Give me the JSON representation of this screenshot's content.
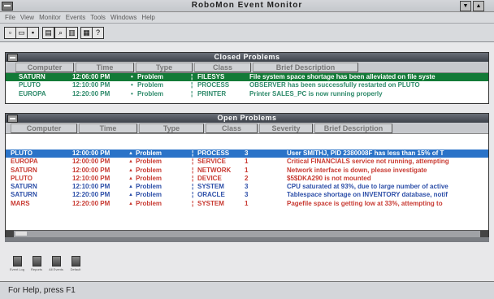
{
  "app": {
    "title": "RoboMon Event Monitor"
  },
  "menu": [
    "File",
    "View",
    "Monitor",
    "Events",
    "Tools",
    "Windows",
    "Help"
  ],
  "toolbar": {
    "icons": [
      "new-icon",
      "open-icon",
      "save-icon",
      "print-icon",
      "find-icon",
      "report-icon",
      "tile-icon",
      "help-icon"
    ]
  },
  "closed": {
    "title": "Closed Problems",
    "headers": [
      "Computer",
      "Time",
      "Type",
      "Class",
      "Brief Description"
    ],
    "rows": [
      {
        "computer": "SATURN",
        "time": "12:06:00 PM",
        "type": "Problem",
        "cls": "FILESYS",
        "desc": "File system space shortage has been alleviated on file syste",
        "sel": true
      },
      {
        "computer": "PLUTO",
        "time": "12:10:00 PM",
        "type": "Problem",
        "cls": "PROCESS",
        "desc": "OBSERVER has been successfully restarted on PLUTO",
        "sel": false
      },
      {
        "computer": "EUROPA",
        "time": "12:20:00 PM",
        "type": "Problem",
        "cls": "PRINTER",
        "desc": "Printer SALES_PC is now running properly",
        "sel": false
      }
    ]
  },
  "open": {
    "title": "Open Problems",
    "headers": [
      "Computer",
      "Time",
      "Type",
      "Class",
      "Severity",
      "Brief Description"
    ],
    "rows": [
      {
        "computer": "PLUTO",
        "time": "12:00:00 PM",
        "type": "Problem",
        "cls": "PROCESS",
        "sev": "3",
        "desc": "User SMITHJ, PID 2380008F has less than 15% of T",
        "sel": true,
        "blue": false
      },
      {
        "computer": "EUROPA",
        "time": "12:00:00 PM",
        "type": "Problem",
        "cls": "SERVICE",
        "sev": "1",
        "desc": "Critical FINANCIALS service not running, attempting",
        "sel": false,
        "blue": false
      },
      {
        "computer": "SATURN",
        "time": "12:00:00 PM",
        "type": "Problem",
        "cls": "NETWORK",
        "sev": "1",
        "desc": "Network interface is down, please investigate",
        "sel": false,
        "blue": false
      },
      {
        "computer": "PLUTO",
        "time": "12:10:00 PM",
        "type": "Problem",
        "cls": "DEVICE",
        "sev": "2",
        "desc": "$5$DKA290 is not mounted",
        "sel": false,
        "blue": false
      },
      {
        "computer": "SATURN",
        "time": "12:10:00 PM",
        "type": "Problem",
        "cls": "SYSTEM",
        "sev": "3",
        "desc": "CPU saturated at 93%, due to large number of active",
        "sel": false,
        "blue": true
      },
      {
        "computer": "SATURN",
        "time": "12:20:00 PM",
        "type": "Problem",
        "cls": "ORACLE",
        "sev": "3",
        "desc": "Tablespace shortage on INVENTORY database, notif",
        "sel": false,
        "blue": true
      },
      {
        "computer": "MARS",
        "time": "12:20:00 PM",
        "type": "Problem",
        "cls": "SYSTEM",
        "sev": "1",
        "desc": "Pagefile space is getting low at 33%, attempting to",
        "sel": false,
        "blue": false
      }
    ]
  },
  "minimized": [
    "Event Log",
    "Reports",
    "All Events",
    "Default"
  ],
  "status": {
    "text": "For Help, press F1"
  },
  "colors": {
    "closed_sel": "#137a37",
    "open_sel": "#2a73c8",
    "open_text": "#c83a32",
    "closed_text": "#2e8a6a"
  }
}
